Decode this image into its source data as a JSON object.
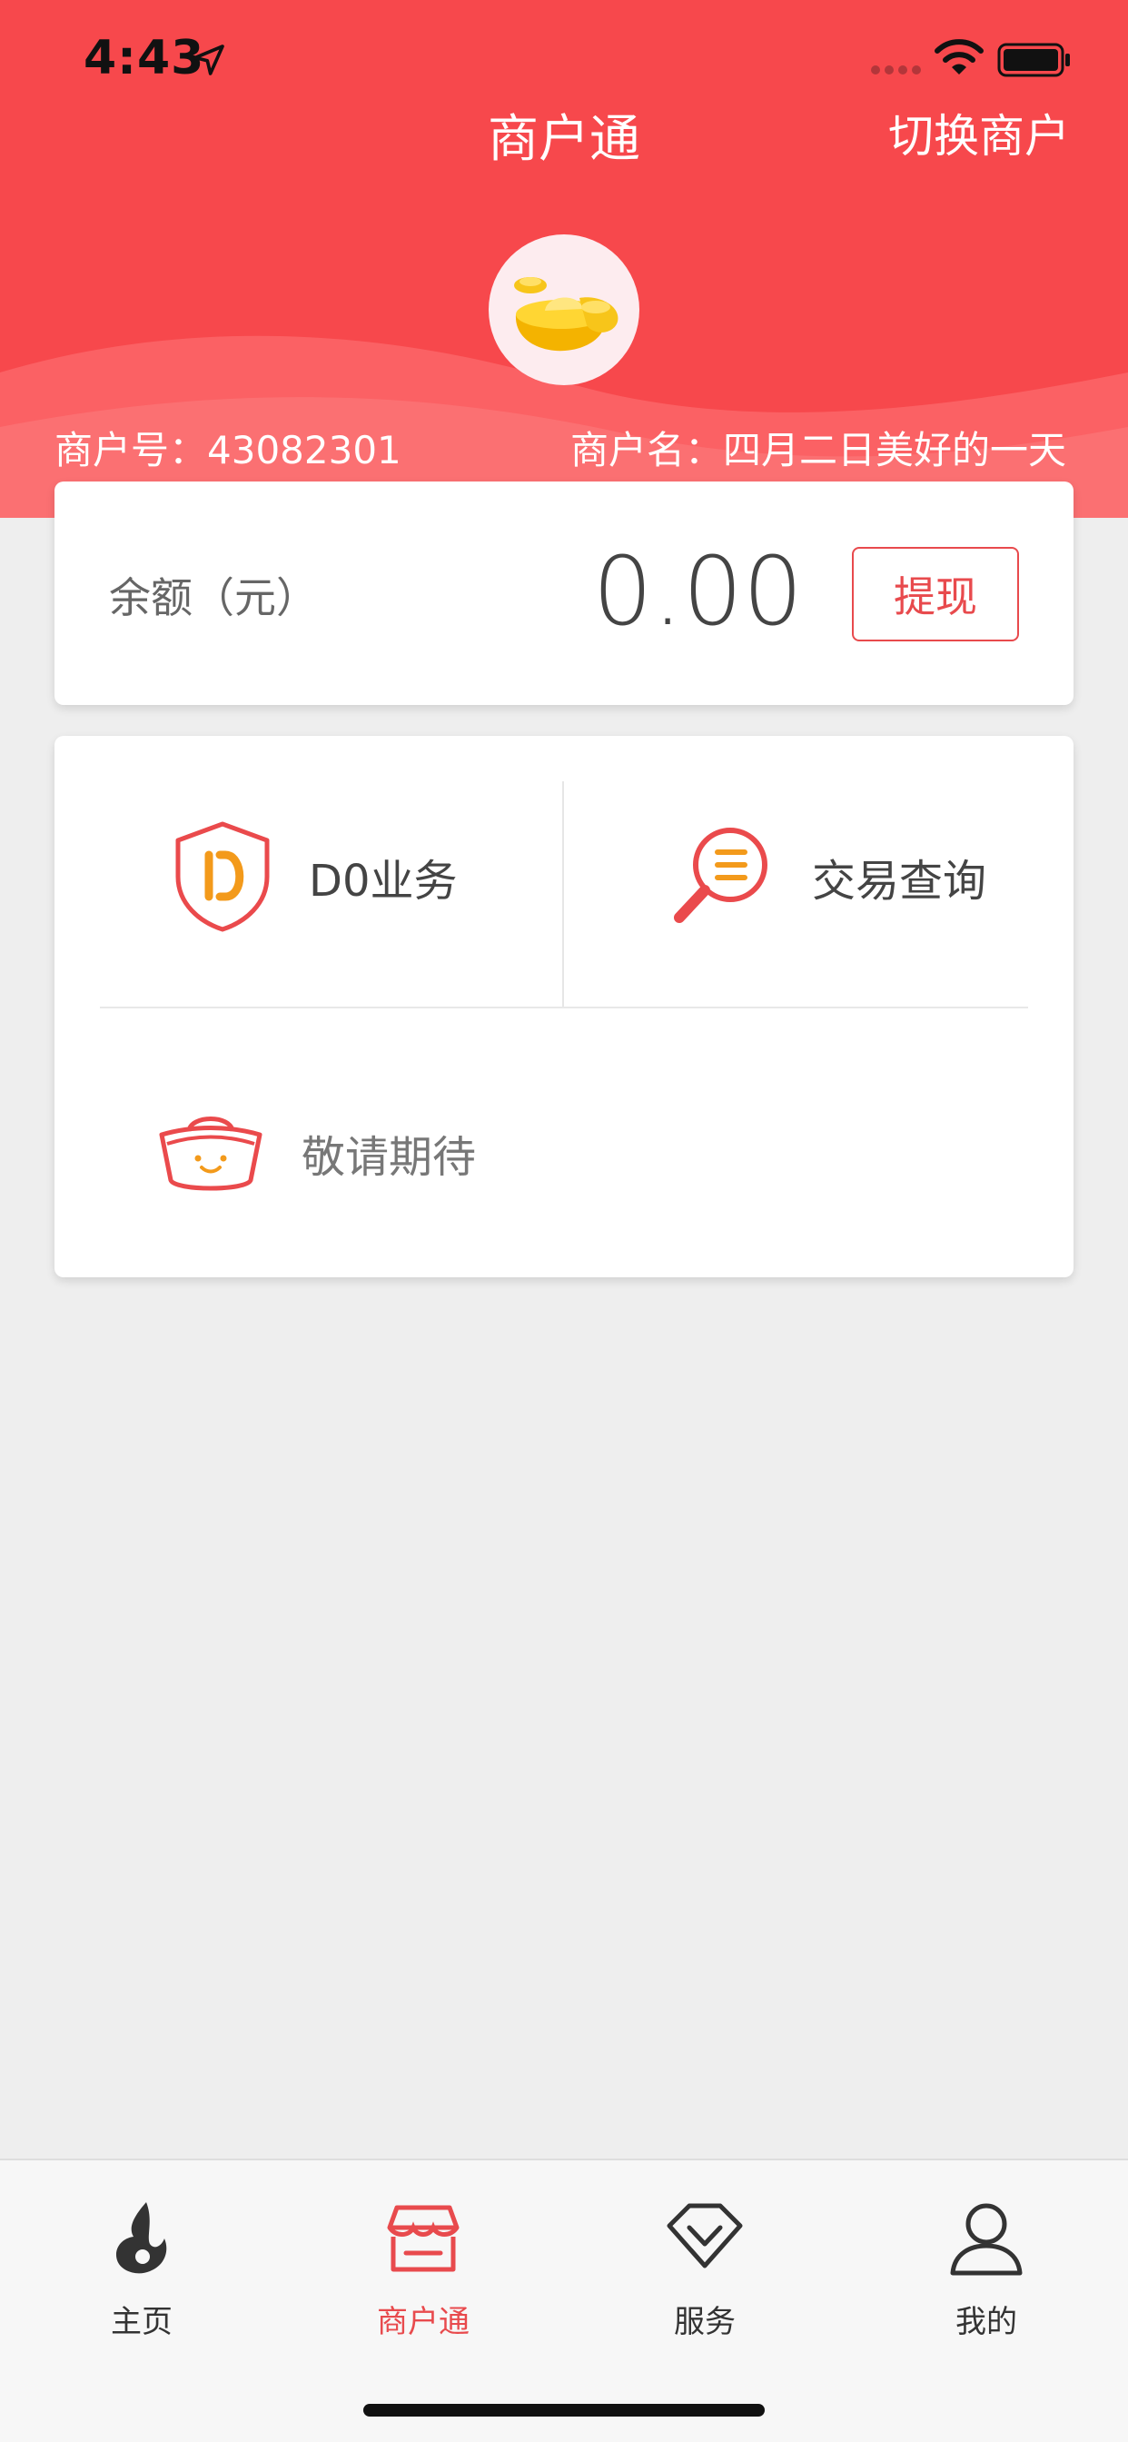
{
  "status_bar": {
    "time": "4:43",
    "icons": [
      "location-arrow-icon",
      "cellular-signal-icon",
      "wifi-icon",
      "battery-icon"
    ]
  },
  "header": {
    "title": "商户通",
    "switch_label": "切换商户",
    "merchant_no": "商户号：43082301",
    "merchant_name": "商户名：四月二日美好的一天",
    "accent": "#f7484c"
  },
  "balance": {
    "label": "余额（元）",
    "value": "0.00",
    "withdraw_label": "提现"
  },
  "services": [
    {
      "label": "D0业务",
      "icon": "d0-shield-icon"
    },
    {
      "label": "交易查询",
      "icon": "search-magnifier-icon"
    },
    {
      "label": "敬请期待",
      "icon": "coming-soon-basket-icon"
    }
  ],
  "tabbar": {
    "tabs": [
      {
        "label": "主页",
        "icon": "flame-home-icon",
        "active": false
      },
      {
        "label": "商户通",
        "icon": "storefront-icon",
        "active": true
      },
      {
        "label": "服务",
        "icon": "diamond-icon",
        "active": false
      },
      {
        "label": "我的",
        "icon": "user-profile-icon",
        "active": false
      }
    ],
    "active_color": "#e84a4d"
  }
}
